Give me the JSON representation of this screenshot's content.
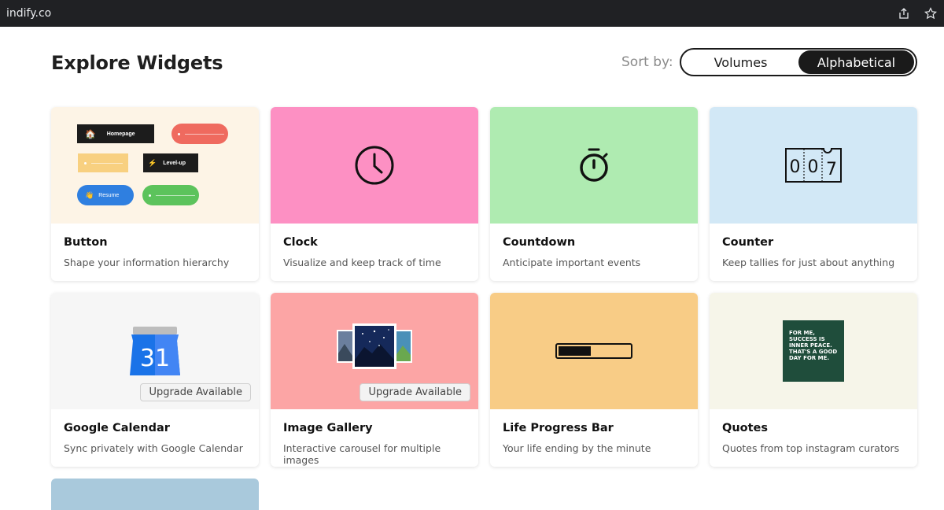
{
  "browser": {
    "url": "indify.co"
  },
  "header": {
    "title": "Explore Widgets",
    "sort_label": "Sort by:",
    "sort_options": [
      "Volumes",
      "Alphabetical"
    ],
    "sort_selected": "Alphabetical"
  },
  "cards": [
    {
      "title": "Button",
      "desc": "Shape your information hierarchy",
      "bg": "#fdf4e6"
    },
    {
      "title": "Clock",
      "desc": "Visualize and keep track of time",
      "bg": "#fd90c3"
    },
    {
      "title": "Countdown",
      "desc": "Anticipate important events",
      "bg": "#afebb1"
    },
    {
      "title": "Counter",
      "desc": "Keep tallies for just about anything",
      "bg": "#d2e8f6"
    },
    {
      "title": "Google Calendar",
      "desc": "Sync privately with Google Calendar",
      "bg": "#f6f6f6",
      "badge": "Upgrade Available"
    },
    {
      "title": "Image Gallery",
      "desc": "Interactive carousel for multiple images",
      "bg": "#fca5a5",
      "badge": "Upgrade Available"
    },
    {
      "title": "Life Progress Bar",
      "desc": "Your life ending by the minute",
      "bg": "#f8cc86"
    },
    {
      "title": "Quotes",
      "desc": "Quotes from top instagram curators",
      "bg": "#f6f5e9"
    }
  ],
  "button_preview": {
    "homepage": "Homepage",
    "levelup": "Level-up",
    "resume": "Resume"
  },
  "counter_digits": [
    "0",
    "0",
    "7"
  ],
  "calendar_day": "31",
  "quote_text": "FOR ME, SUCCESS IS INNER PEACE. THAT'S A GOOD DAY FOR ME.",
  "progress": 0.45
}
